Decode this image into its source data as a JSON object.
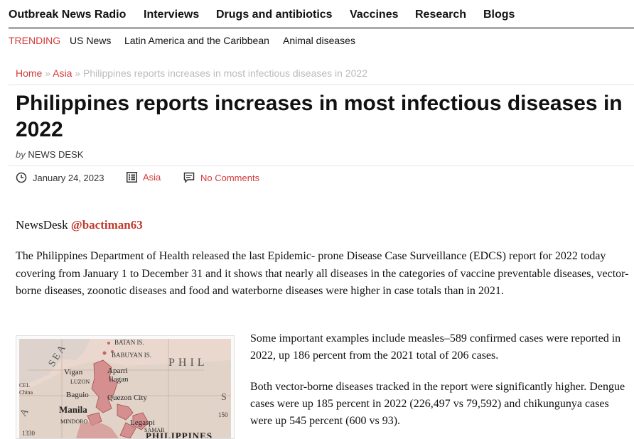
{
  "nav": {
    "items": [
      "Outbreak News Radio",
      "Interviews",
      "Drugs and antibiotics",
      "Vaccines",
      "Research",
      "Blogs"
    ]
  },
  "trending": {
    "label": "TRENDING",
    "links": [
      "US News",
      "Latin America and the Caribbean",
      "Animal diseases"
    ]
  },
  "breadcrumb": {
    "home": "Home",
    "sep": "»",
    "category": "Asia",
    "current": "Philippines reports increases in most infectious diseases in 2022"
  },
  "article": {
    "title": "Philippines reports increases in most infectious diseases in 2022",
    "by": "by",
    "author": "NEWS DESK",
    "date": "January 24, 2023",
    "category": "Asia",
    "comments": "No Comments",
    "source_prefix": "NewsDesk",
    "source_handle": "@bactiman63",
    "paragraph1": "The Philippines Department of Health released the last Epidemic- prone Disease Case Surveillance (EDCS) report for 2022 today covering from January 1 to December 31 and it shows that nearly all diseases in the categories of vaccine preventable diseases, vector-borne diseases, zoonotic diseases and food and waterborne diseases were higher in case totals than in 2021.",
    "paragraph2": "Some important examples include measles–589 confirmed cases were reported in 2022, up 186 percent from the 2021 total of 206 cases.",
    "paragraph3": "Both vector-borne diseases tracked in the report were significantly higher. Dengue cases were up 185 percent in 2022 (226,497 vs 79,592) and chikungunya cases were up 545 percent (600 vs 93)."
  },
  "map": {
    "labels": [
      "BATAN IS.",
      "BABUYAN IS.",
      "PHIL",
      "SEA",
      "Vigan",
      "Aparri",
      "Ilagan",
      "LUZON",
      "CEL",
      "China",
      "Baguio",
      "Quezon City",
      "S",
      "Manila",
      "MINDORO",
      "Legaspi",
      "SAMAR",
      "PHILIPPINES",
      "1330",
      "150",
      "A"
    ]
  }
}
